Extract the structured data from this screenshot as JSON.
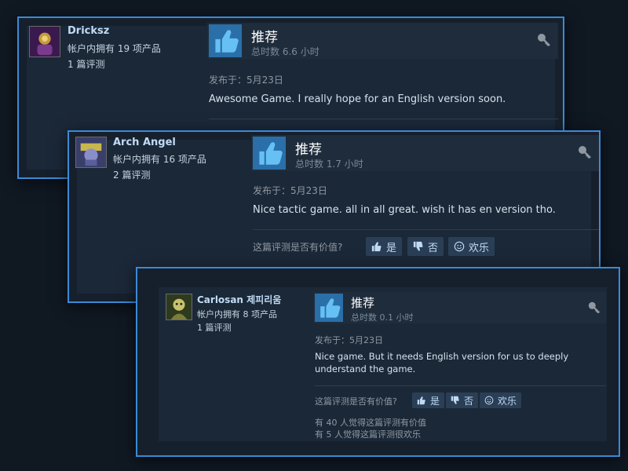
{
  "reviews": [
    {
      "username": "Dricksz",
      "products": "帐户内拥有 19 项产品",
      "reviews_count": "1 篇评测",
      "recommendation": "推荐",
      "hours": "总时数 6.6 小时",
      "posted": "发布于：5月23日",
      "text": "Awesome Game. I really hope for an English version soon.",
      "avatar_color": "#5a2a6e"
    },
    {
      "username": "Arch Angel",
      "products": "帐户内拥有 16 项产品",
      "reviews_count": "2 篇评测",
      "recommendation": "推荐",
      "hours": "总时数 1.7 小时",
      "posted": "发布于：5月23日",
      "text": "Nice tactic game. all in all great. wish it has en version tho.",
      "helpful_question": "这篇评测是否有价值?",
      "yes": "是",
      "no": "否",
      "funny": "欢乐",
      "avatar_color": "#4a4e8a"
    },
    {
      "username": "Carlosan 제피리움",
      "products": "帐户内拥有 8 项产品",
      "reviews_count": "1 篇评测",
      "recommendation": "推荐",
      "hours": "总时数 0.1 小时",
      "posted": "发布于：5月23日",
      "text": "Nice game. But it needs English version for us to deeply understand the game.",
      "helpful_question": "这篇评测是否有价值?",
      "yes": "是",
      "no": "否",
      "funny": "欢乐",
      "helpful_count": "有 40 人觉得这篇评测有价值",
      "funny_count": "有 5 人觉得这篇评测很欢乐",
      "avatar_color": "#5a5a30"
    }
  ],
  "colors": {
    "accent_border": "#3b8ad6",
    "thumb_bg": "#2a6fa8",
    "button_bg": "#2a3f56"
  },
  "icons": {
    "thumb": "thumbs-up-icon",
    "award": "award-icon",
    "no": "thumbs-down-icon",
    "funny": "smiley-icon"
  }
}
